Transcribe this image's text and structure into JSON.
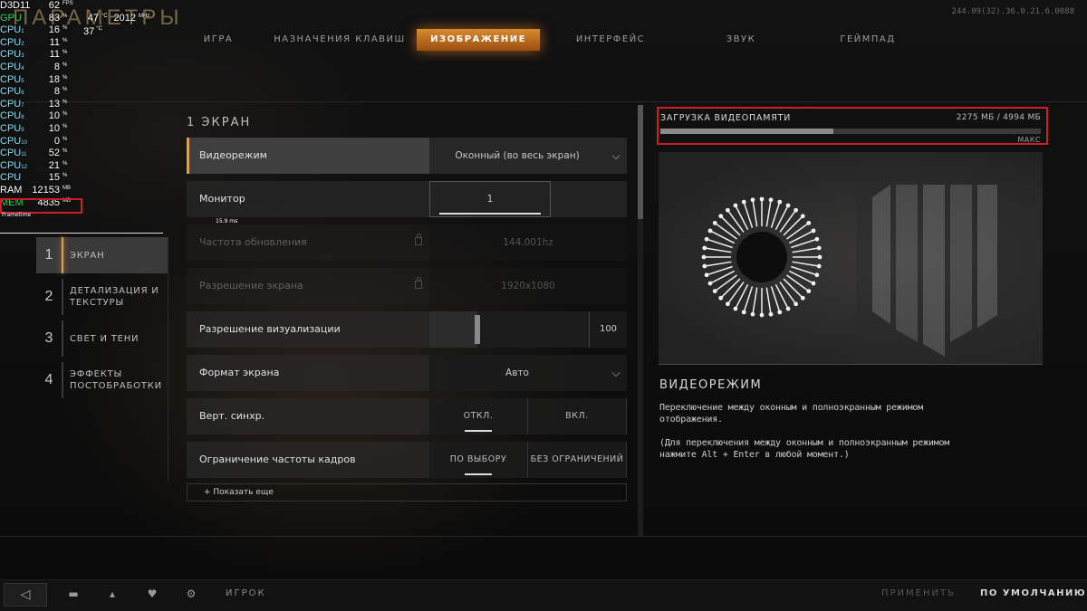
{
  "page": {
    "title": "ПАРАМЕТРЫ",
    "build": "244.09(32).36.0.21.6.0088"
  },
  "tabs": [
    "ИГРА",
    "НАЗНАЧЕНИЯ КЛАВИШ",
    "ИЗОБРАЖЕНИЕ",
    "ИНТЕРФЕЙС",
    "ЗВУК",
    "ГЕЙМПАД"
  ],
  "osd": {
    "d3d": {
      "label": "D3D11",
      "value": "62",
      "unit": "FPS"
    },
    "gpu": {
      "label": "GPU",
      "value": "83",
      "unit": "%",
      "temp": "47",
      "temp_unit": "°C",
      "clock": "2012",
      "clock_unit": "MHz"
    },
    "cpu_temp": {
      "value": "37",
      "unit": "°C"
    },
    "cpus": [
      {
        "label": "CPU",
        "sub": "1",
        "value": "16"
      },
      {
        "label": "CPU",
        "sub": "2",
        "value": "11"
      },
      {
        "label": "CPU",
        "sub": "3",
        "value": "11"
      },
      {
        "label": "CPU",
        "sub": "4",
        "value": "8"
      },
      {
        "label": "CPU",
        "sub": "5",
        "value": "18"
      },
      {
        "label": "CPU",
        "sub": "6",
        "value": "8"
      },
      {
        "label": "CPU",
        "sub": "7",
        "value": "13"
      },
      {
        "label": "CPU",
        "sub": "8",
        "value": "10"
      },
      {
        "label": "CPU",
        "sub": "9",
        "value": "10"
      },
      {
        "label": "CPU",
        "sub": "10",
        "value": "0"
      },
      {
        "label": "CPU",
        "sub": "11",
        "value": "52"
      },
      {
        "label": "CPU",
        "sub": "12",
        "value": "21"
      },
      {
        "label": "CPU",
        "sub": "",
        "value": "15"
      }
    ],
    "cpu_unit": "%",
    "ram": {
      "label": "RAM",
      "value": "12153",
      "unit": "MB"
    },
    "mem": {
      "label": "MEM",
      "value": "4835",
      "unit": "MB"
    },
    "frametime_label": "Frametime",
    "frametime_ms": "15.9 ms"
  },
  "sidebar": {
    "items": [
      {
        "num": "1",
        "label": "ЭКРАН"
      },
      {
        "num": "2",
        "label": "ДЕТАЛИЗАЦИЯ И\nТЕКСТУРЫ"
      },
      {
        "num": "3",
        "label": "СВЕТ И ТЕНИ"
      },
      {
        "num": "4",
        "label": "ЭФФЕКТЫ\nПОСТОБРАБОТКИ"
      }
    ]
  },
  "section": {
    "num": "1",
    "title": "ЭКРАН"
  },
  "settings": {
    "display_mode": {
      "label": "Видеорежим",
      "value": "Оконный (во весь экран)"
    },
    "monitor": {
      "label": "Монитор",
      "value": "1"
    },
    "refresh_rate": {
      "label": "Частота обновления",
      "value": "144.001hz"
    },
    "screen_res": {
      "label": "Разрешение экрана",
      "value": "1920x1080"
    },
    "render_res": {
      "label": "Разрешение визуализации",
      "value": "100",
      "fraction": 0.3
    },
    "aspect": {
      "label": "Формат экрана",
      "value": "Авто"
    },
    "vsync": {
      "label": "Верт. синхр.",
      "options": [
        "ОТКЛ.",
        "ВКЛ."
      ]
    },
    "frame_limit": {
      "label": "Ограничение частоты кадров",
      "options": [
        "ПО ВЫБОРУ",
        "БЕЗ ОГРАНИЧЕНИЙ"
      ]
    },
    "show_more": "+ Показать еще"
  },
  "vram": {
    "label": "ЗАГРУЗКА ВИДЕОПАМЯТИ",
    "value": "2275 МБ / 4994 МБ",
    "fraction": 0.455,
    "max_label": "МАКС"
  },
  "description": {
    "title": "ВИДЕОРЕЖИМ",
    "text": "Переключение между оконным и полноэкранным режимом\nотображения.\n\n(Для переключения между оконным и полноэкранным режимом\nнажмите Alt + Enter в любой момент.)"
  },
  "bottom": {
    "player_label": "ИГРОК",
    "apply_label": "ПРИМЕНИТЬ",
    "default_label": "ПО УМОЛЧАНИЮ"
  },
  "colors": {
    "accent": "#d98a2d",
    "highlight_box": "#d11a2a",
    "osd_green": "#22dd55",
    "osd_cyan": "#7de4ff"
  },
  "icons": [
    "back-arrow-icon",
    "chat-icon",
    "player-icon",
    "party-icon",
    "gear-icon",
    "lock-icon",
    "chevron-down-icon",
    "sunburst-icon",
    "bo4-emblem-icon"
  ]
}
